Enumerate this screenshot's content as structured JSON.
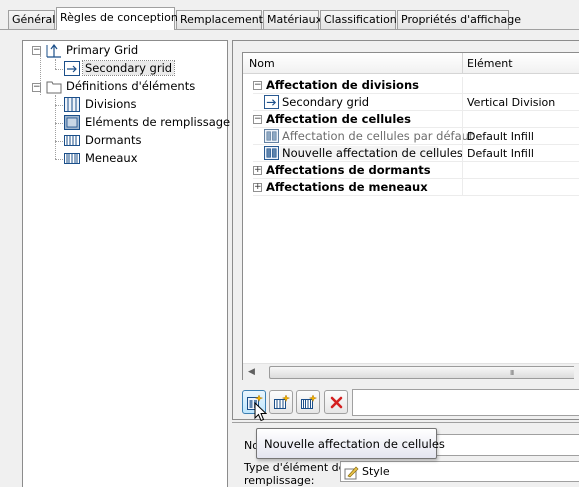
{
  "tabs": [
    {
      "label": "Général"
    },
    {
      "label": "Règles de conception"
    },
    {
      "label": "Remplacements"
    },
    {
      "label": "Matériaux"
    },
    {
      "label": "Classifications"
    },
    {
      "label": "Propriétés d'affichage"
    }
  ],
  "active_tab": "Règles de conception",
  "tree": {
    "primary_grid": "Primary Grid",
    "secondary_grid": "Secondary grid",
    "element_definitions": "Définitions d'éléments",
    "divisions": "Divisions",
    "infill_elements": "Eléments de remplissage",
    "frames": "Dormants",
    "mullions": "Meneaux"
  },
  "grid": {
    "columns": {
      "name": "Nom",
      "element": "Elément"
    },
    "rows": [
      {
        "name": "Affectation de divisions",
        "element": "",
        "group": true,
        "state": "expanded"
      },
      {
        "name": "Secondary grid",
        "element": "Vertical Division",
        "group": false
      },
      {
        "name": "Affectation de cellules",
        "element": "",
        "group": true,
        "state": "expanded"
      },
      {
        "name": "Affectation de cellules par défaut",
        "element": "Default Infill",
        "group": false,
        "dimmed": true
      },
      {
        "name": "Nouvelle affectation de cellules",
        "element": "Default Infill",
        "group": false,
        "highlighted": true
      },
      {
        "name": "Affectations de dormants",
        "element": "",
        "group": true,
        "state": "collapsed"
      },
      {
        "name": "Affectations de meneaux",
        "element": "",
        "group": true,
        "state": "collapsed"
      }
    ],
    "scroll_grip": "III"
  },
  "toolbar": {
    "buttons": [
      {
        "icon": "new-cell-assignment-icon",
        "active": true
      },
      {
        "icon": "new-frame-assignment-icon",
        "active": false
      },
      {
        "icon": "new-mullion-assignment-icon",
        "active": false
      },
      {
        "icon": "delete-icon",
        "active": false,
        "color": "#d42020"
      }
    ]
  },
  "properties": {
    "name_label": "No",
    "element_type_label_line1": "Type d'élément de",
    "element_type_label_line2": "remplissage:",
    "element_type_value": "Style"
  },
  "tooltip": {
    "text": "Nouvelle affectation de cellules"
  },
  "colors": {
    "tab_border": "#a0a0a0",
    "panel_bg": "#f0f0f0",
    "active_button_border": "#3c7fb1",
    "delete_red": "#d42020"
  }
}
